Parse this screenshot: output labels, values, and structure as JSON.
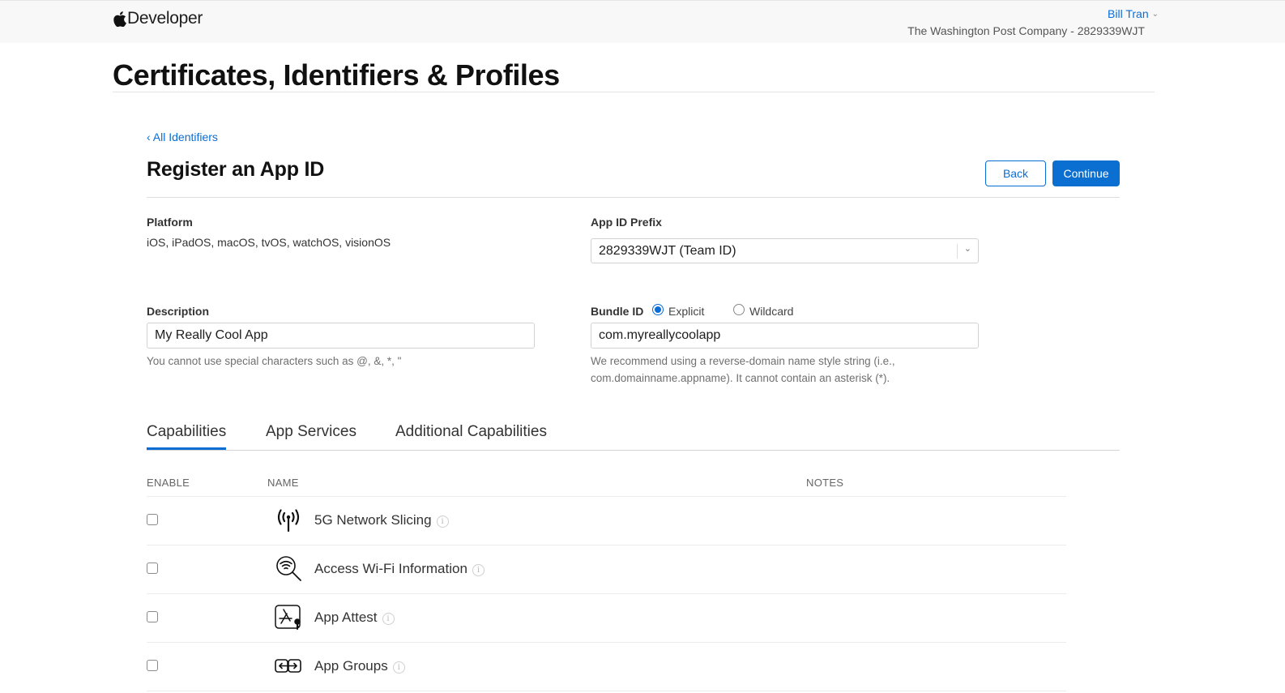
{
  "header": {
    "brand": "Developer",
    "user_name": "Bill Tran",
    "team": "The Washington Post Company - 2829339WJT"
  },
  "page_title": "Certificates, Identifiers & Profiles",
  "breadcrumb": {
    "back_link": "‹ All Identifiers"
  },
  "section": {
    "title": "Register an App ID",
    "back_label": "Back",
    "continue_label": "Continue"
  },
  "form": {
    "platform": {
      "label": "Platform",
      "value": "iOS, iPadOS, macOS, tvOS, watchOS, visionOS"
    },
    "app_id_prefix": {
      "label": "App ID Prefix",
      "selected": "2829339WJT (Team ID)"
    },
    "description": {
      "label": "Description",
      "value": "My Really Cool App",
      "helper": "You cannot use special characters such as @, &, *, \""
    },
    "bundle_id": {
      "label": "Bundle ID",
      "options": [
        {
          "label": "Explicit",
          "checked": true
        },
        {
          "label": "Wildcard",
          "checked": false
        }
      ],
      "value": "com.myreallycoolapp",
      "helper_line1": "We recommend using a reverse-domain name style string (i.e.,",
      "helper_line2": "com.domainname.appname). It cannot contain an asterisk (*)."
    }
  },
  "tabs": [
    {
      "label": "Capabilities",
      "active": true
    },
    {
      "label": "App Services",
      "active": false
    },
    {
      "label": "Additional Capabilities",
      "active": false
    }
  ],
  "table": {
    "columns": [
      "ENABLE",
      "NAME",
      "NOTES"
    ],
    "rows": [
      {
        "name": "5G Network Slicing",
        "icon": "antenna-icon",
        "enabled": false,
        "notes": ""
      },
      {
        "name": "Access Wi-Fi Information",
        "icon": "wifi-search-icon",
        "enabled": false,
        "notes": ""
      },
      {
        "name": "App Attest",
        "icon": "app-store-key-icon",
        "enabled": false,
        "notes": ""
      },
      {
        "name": "App Groups",
        "icon": "app-groups-icon",
        "enabled": false,
        "notes": ""
      }
    ]
  },
  "colors": {
    "accent": "#0a6dd6",
    "primary_button": "#0a6fd0",
    "topbar_bg": "#f8f8f8"
  }
}
